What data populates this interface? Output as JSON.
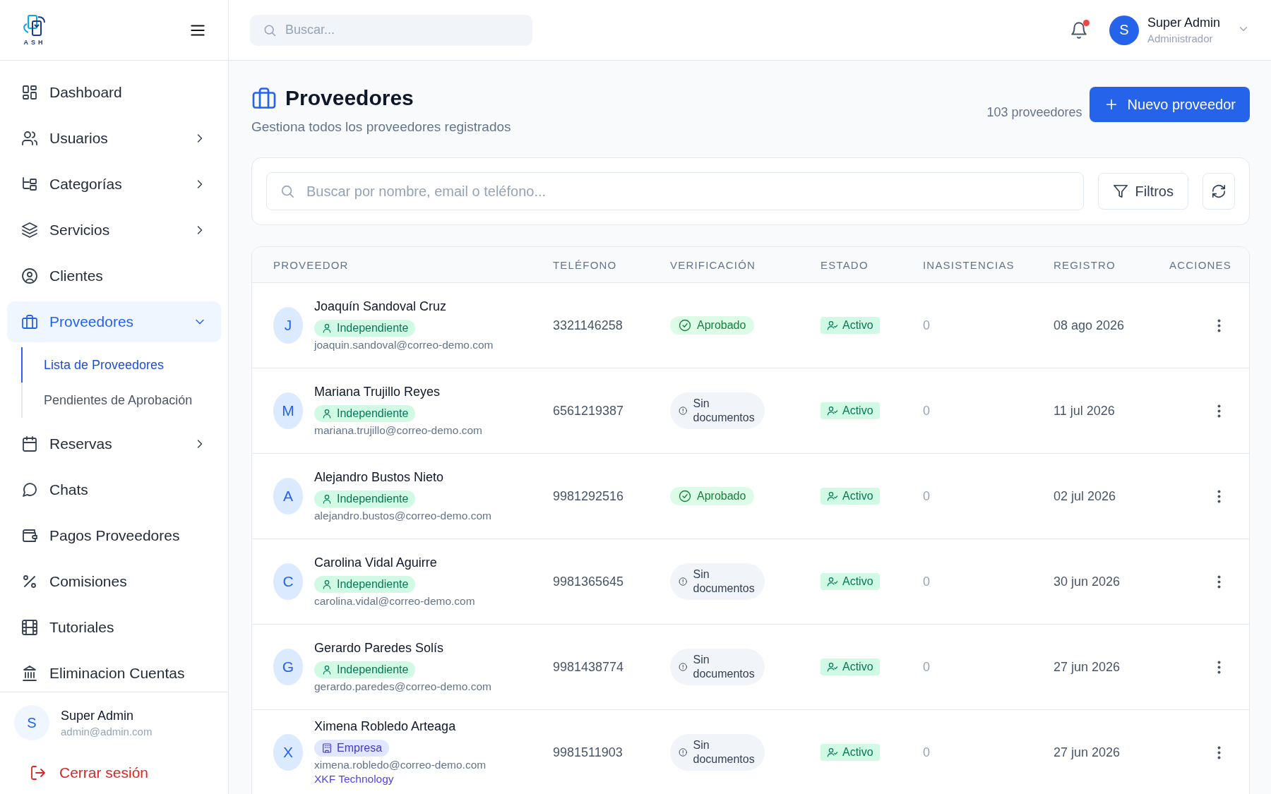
{
  "sidebar": {
    "logo_text": "ASH",
    "items": [
      {
        "label": "Dashboard",
        "selected": false
      },
      {
        "label": "Usuarios",
        "selected": false,
        "expanded": false
      },
      {
        "label": "Categorías",
        "selected": false,
        "expanded": false
      },
      {
        "label": "Servicios",
        "selected": false,
        "expanded": false
      },
      {
        "label": "Clientes",
        "selected": false
      },
      {
        "label": "Proveedores",
        "selected": true,
        "expanded": true,
        "children": [
          {
            "label": "Lista de Proveedores",
            "selected": true
          },
          {
            "label": "Pendientes de Aprobación",
            "selected": false
          }
        ]
      },
      {
        "label": "Reservas",
        "selected": false,
        "expanded": false
      },
      {
        "label": "Chats",
        "selected": false
      },
      {
        "label": "Pagos Proveedores",
        "selected": false
      },
      {
        "label": "Comisiones",
        "selected": false
      },
      {
        "label": "Tutoriales",
        "selected": false
      },
      {
        "label": "Eliminacion Cuentas",
        "selected": false
      }
    ],
    "user": {
      "initial": "S",
      "name": "Super Admin",
      "email": "admin@admin.com"
    },
    "logout": "Cerrar sesión"
  },
  "header": {
    "search": {
      "placeholder": "Buscar..."
    },
    "notifications_unread": true,
    "user": {
      "initial": "S",
      "name": "Super Admin",
      "role": "Administrador"
    }
  },
  "page": {
    "title": "Proveedores",
    "subtitle": "Gestiona todos los proveedores registrados",
    "count": "103 proveedores",
    "new_button": "Nuevo proveedor",
    "search": {
      "placeholder": "Buscar por nombre, email o teléfono..."
    },
    "filters_button": "Filtros"
  },
  "table": {
    "columns": [
      "PROVEEDOR",
      "TELÉFONO",
      "VERIFICACIÓN",
      "ESTADO",
      "INASISTENCIAS",
      "REGISTRO",
      "ACCIONES"
    ],
    "rows": [
      {
        "initial": "J",
        "name": "Joaquín Sandoval Cruz",
        "type": {
          "kind": "independent",
          "label": "Independiente"
        },
        "email": "joaquin.sandoval@correo-demo.com",
        "phone": "3321146258",
        "verification": {
          "kind": "approved",
          "label": "Aprobado"
        },
        "status": {
          "kind": "active",
          "label": "Activo"
        },
        "absences": "0",
        "registered": "08 ago 2026"
      },
      {
        "initial": "M",
        "name": "Mariana Trujillo Reyes",
        "type": {
          "kind": "independent",
          "label": "Independiente"
        },
        "email": "mariana.trujillo@correo-demo.com",
        "phone": "6561219387",
        "verification": {
          "kind": "missing",
          "label": "Sin documentos"
        },
        "status": {
          "kind": "active",
          "label": "Activo"
        },
        "absences": "0",
        "registered": "11 jul 2026"
      },
      {
        "initial": "A",
        "name": "Alejandro Bustos Nieto",
        "type": {
          "kind": "independent",
          "label": "Independiente"
        },
        "email": "alejandro.bustos@correo-demo.com",
        "phone": "9981292516",
        "verification": {
          "kind": "approved",
          "label": "Aprobado"
        },
        "status": {
          "kind": "active",
          "label": "Activo"
        },
        "absences": "0",
        "registered": "02 jul 2026"
      },
      {
        "initial": "C",
        "name": "Carolina Vidal Aguirre",
        "type": {
          "kind": "independent",
          "label": "Independiente"
        },
        "email": "carolina.vidal@correo-demo.com",
        "phone": "9981365645",
        "verification": {
          "kind": "missing",
          "label": "Sin documentos"
        },
        "status": {
          "kind": "active",
          "label": "Activo"
        },
        "absences": "0",
        "registered": "30 jun 2026"
      },
      {
        "initial": "G",
        "name": "Gerardo Paredes Solís",
        "type": {
          "kind": "independent",
          "label": "Independiente"
        },
        "email": "gerardo.paredes@correo-demo.com",
        "phone": "9981438774",
        "verification": {
          "kind": "missing",
          "label": "Sin documentos"
        },
        "status": {
          "kind": "active",
          "label": "Activo"
        },
        "absences": "0",
        "registered": "27 jun 2026"
      },
      {
        "initial": "X",
        "name": "Ximena Robledo Arteaga",
        "type": {
          "kind": "company",
          "label": "Empresa"
        },
        "email": "ximena.robledo@correo-demo.com",
        "company": "XKF Technology",
        "phone": "9981511903",
        "verification": {
          "kind": "missing",
          "label": "Sin documentos"
        },
        "status": {
          "kind": "active",
          "label": "Activo"
        },
        "absences": "0",
        "registered": "27 jun 2026"
      }
    ]
  }
}
